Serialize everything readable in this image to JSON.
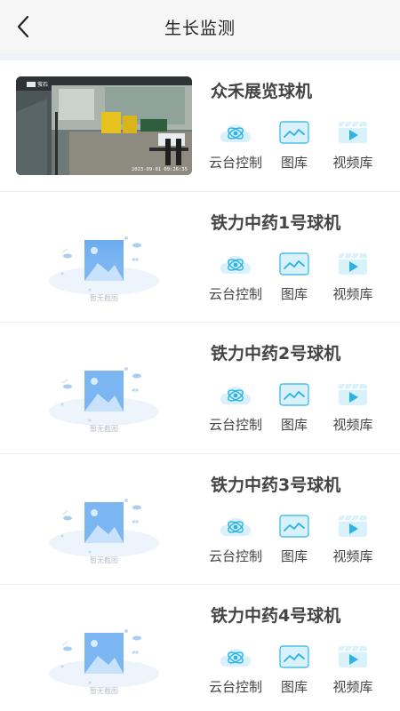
{
  "header": {
    "title": "生长监测"
  },
  "actions": {
    "ptz_label": "云台控制",
    "gallery_label": "图库",
    "video_label": "视频库"
  },
  "empty_thumb_label": "暂无截图",
  "cameras": [
    {
      "name": "众禾展览球机",
      "snapshot": "2023-09-01 09:26:35",
      "brand": "萤石"
    },
    {
      "name": "铁力中药1号球机"
    },
    {
      "name": "铁力中药2号球机"
    },
    {
      "name": "铁力中药3号球机"
    },
    {
      "name": "铁力中药4号球机"
    }
  ],
  "colors": {
    "accent": "#2bb3e8",
    "icon_bg": "#d9f1fb"
  }
}
